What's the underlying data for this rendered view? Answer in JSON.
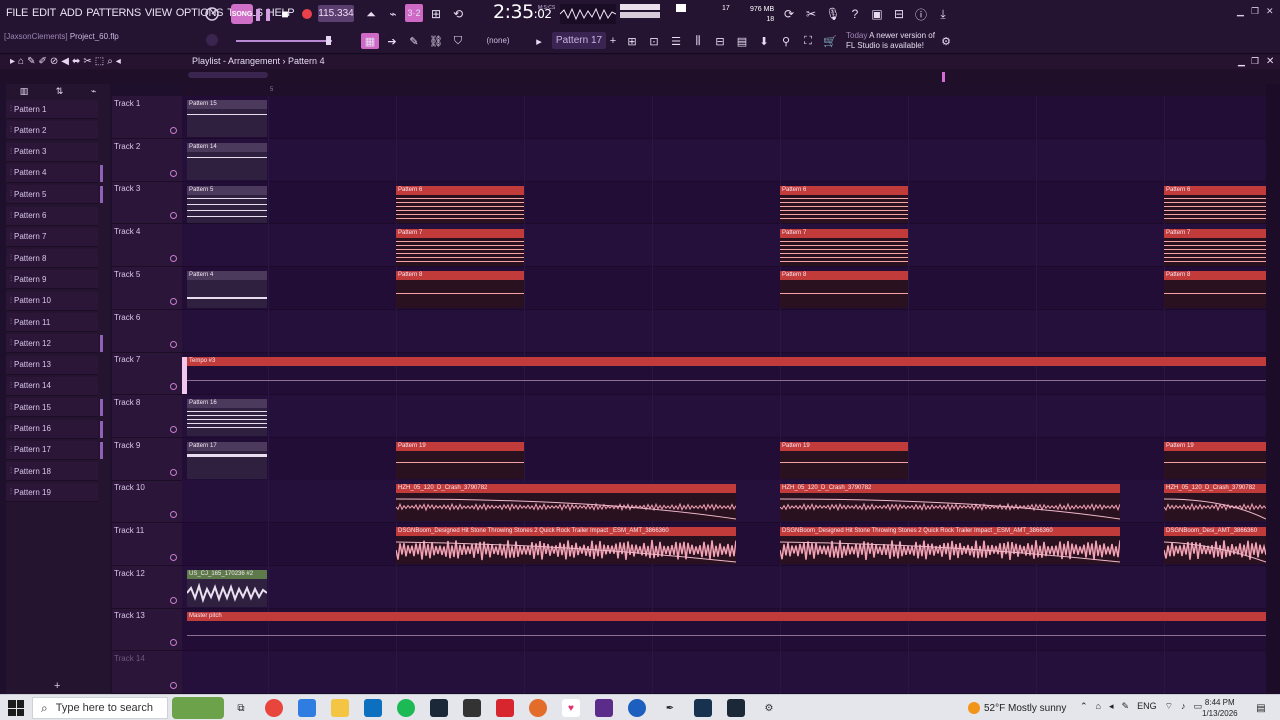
{
  "menu": [
    "FILE",
    "EDIT",
    "ADD",
    "PATTERNS",
    "VIEW",
    "OPTIONS",
    "TOOLS",
    "HELP"
  ],
  "project": {
    "user": "[JaxsonClements]",
    "file": "Project_60.flp"
  },
  "transport": {
    "song_mode": "SONG",
    "tempo": "115.334",
    "time": "2:35",
    "time_sub": ":02",
    "time_unit": "M:S:CS"
  },
  "meters": {
    "cpu": "17",
    "mem": "976 MB",
    "poly": "18"
  },
  "toolbar": {
    "snap": "(none)",
    "pattern": "Pattern 17"
  },
  "news": {
    "today": "Today",
    "message_line1": "A newer version of",
    "message_line2": "FL Studio is available!"
  },
  "playlist": {
    "title": "Playlist - Arrangement",
    "current_pattern": "Pattern 4"
  },
  "ruler": {
    "marks": [
      "5"
    ]
  },
  "patterns": [
    "Pattern 1",
    "Pattern 2",
    "Pattern 3",
    "Pattern 4",
    "Pattern 5",
    "Pattern 6",
    "Pattern 7",
    "Pattern 8",
    "Pattern 9",
    "Pattern 10",
    "Pattern 11",
    "Pattern 12",
    "Pattern 13",
    "Pattern 14",
    "Pattern 15",
    "Pattern 16",
    "Pattern 17",
    "Pattern 18",
    "Pattern 19"
  ],
  "tracks": [
    "Track 1",
    "Track 2",
    "Track 3",
    "Track 4",
    "Track 5",
    "Track 6",
    "Track 7",
    "Track 8",
    "Track 9",
    "Track 10",
    "Track 11",
    "Track 12",
    "Track 13",
    "Track 14"
  ],
  "clips": {
    "p15": "Pattern 15",
    "p14": "Pattern 14",
    "p5": "Pattern 5",
    "p4": "Pattern 4",
    "p6": "Pattern 6",
    "p7": "Pattern 7",
    "p8": "Pattern 8",
    "tempo": "Tempo #3",
    "p16": "Pattern 16",
    "p17": "Pattern 17",
    "p19": "Pattern 19",
    "crash": "HZH_05_120_D_Crash_3790782",
    "stones": "DSGNBoom_Designed Hit Stone Throwing Stones 2 Quick Rock Trailer Impact _ESM_AMT_3866360",
    "stones_short": "DSGNBoom_Desi_AMT_3866360",
    "us": "US_CJ_165_170236 #2",
    "master": "Master pitch"
  },
  "taskbar": {
    "search_placeholder": "Type here to search",
    "weather": "52°F  Mostly sunny",
    "lang": "ENG",
    "time": "8:44 PM",
    "date": "1/13/2026"
  }
}
